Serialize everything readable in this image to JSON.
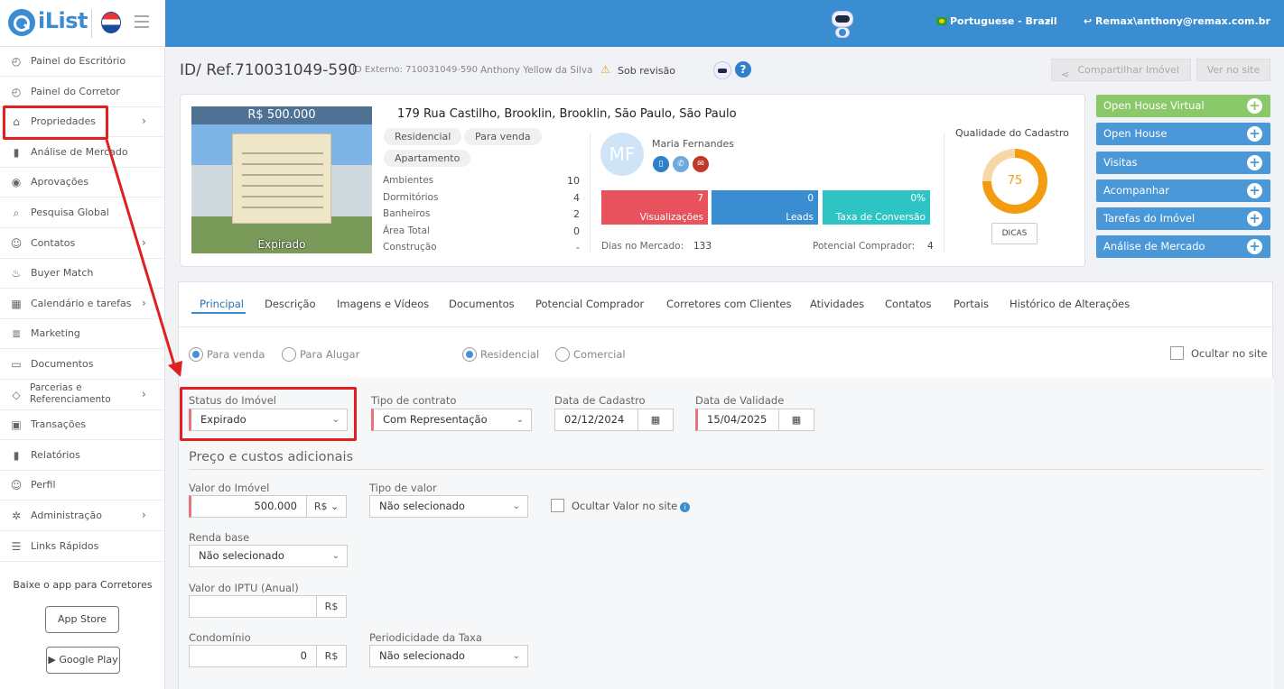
{
  "topbar": {
    "logo": "iList",
    "language": "Portuguese - Brazil",
    "user": "Remax\\anthony@remax.com.br"
  },
  "sidebar": {
    "items": [
      {
        "label": "Painel do Escritório",
        "icon": "dashboard-icon",
        "has_arrow": false
      },
      {
        "label": "Painel do Corretor",
        "icon": "dashboard-icon",
        "has_arrow": false
      },
      {
        "label": "Propriedades",
        "icon": "home-icon",
        "has_arrow": true
      },
      {
        "label": "Análise de Mercado",
        "icon": "bar-chart-icon",
        "has_arrow": false
      },
      {
        "label": "Aprovações",
        "icon": "eye-icon",
        "has_arrow": false
      },
      {
        "label": "Pesquisa Global",
        "icon": "search-icon",
        "has_arrow": false
      },
      {
        "label": "Contatos",
        "icon": "contacts-icon",
        "has_arrow": true
      },
      {
        "label": "Buyer Match",
        "icon": "fire-icon",
        "has_arrow": false
      },
      {
        "label": "Calendário e tarefas",
        "icon": "calendar-icon",
        "has_arrow": true
      },
      {
        "label": "Marketing",
        "icon": "newspaper-icon",
        "has_arrow": false
      },
      {
        "label": "Documentos",
        "icon": "folder-icon",
        "has_arrow": false
      },
      {
        "label": "Parcerias e Referenciamento",
        "icon": "handshake-icon",
        "has_arrow": true
      },
      {
        "label": "Transações",
        "icon": "briefcase-icon",
        "has_arrow": false
      },
      {
        "label": "Relatórios",
        "icon": "bar-chart-icon",
        "has_arrow": false
      },
      {
        "label": "Perfil",
        "icon": "user-icon",
        "has_arrow": false
      },
      {
        "label": "Administração",
        "icon": "gear-icon",
        "has_arrow": true
      },
      {
        "label": "Links Rápidos",
        "icon": "list-icon",
        "has_arrow": false
      }
    ],
    "app_promo": "Baixe o app para Corretores",
    "app_store": "App Store",
    "google_play": "Google Play"
  },
  "header": {
    "title": "ID/ Ref.710031049-590",
    "external_id": "ID Externo: 710031049-590",
    "agent_name": "Anthony Yellow da Silva",
    "status": "Sob revisão",
    "share_label": "Compartilhar Imóvel",
    "view_label": "Ver no site"
  },
  "property": {
    "price": "R$ 500.000",
    "photo_status": "Expirado",
    "address": "179 Rua Castilho, Brooklin, Brooklin, São Paulo, São Paulo",
    "chips": [
      "Residencial",
      "Para venda",
      "Apartamento"
    ],
    "attributes": [
      {
        "label": "Ambientes",
        "value": "10"
      },
      {
        "label": "Dormitórios",
        "value": "4"
      },
      {
        "label": "Banheiros",
        "value": "2"
      },
      {
        "label": "Área Total",
        "value": "0"
      },
      {
        "label": "Construção",
        "value": "-"
      }
    ],
    "agent": {
      "initials": "MF",
      "name": "Maria Fernandes"
    },
    "stats": [
      {
        "value": "7",
        "label": "Visualizações",
        "color": "#e8525c"
      },
      {
        "value": "0",
        "label": "Leads",
        "color": "#3a8dd1"
      },
      {
        "value": "0%",
        "label": "Taxa de Conversão",
        "color": "#2ec4c4"
      }
    ],
    "days_label": "Dias no Mercado:",
    "days_value": "133",
    "potential_label": "Potencial Comprador:",
    "potential_value": "4",
    "quality_title": "Qualidade do Cadastro",
    "quality_score": 75,
    "quality_color": "#f39c12",
    "dicas": "DICAS"
  },
  "actions": [
    {
      "label": "Open House Virtual",
      "color": "#8bc86a"
    },
    {
      "label": "Open House",
      "color": "#4a98d8"
    },
    {
      "label": "Visitas",
      "color": "#4a98d8"
    },
    {
      "label": "Acompanhar",
      "color": "#4a98d8"
    },
    {
      "label": "Tarefas do Imóvel",
      "color": "#4a98d8"
    },
    {
      "label": "Análise de Mercado",
      "color": "#4a98d8"
    }
  ],
  "tabs": [
    "Principal",
    "Descrição",
    "Imagens e Vídeos",
    "Documentos",
    "Potencial Comprador",
    "Corretores com Clientes",
    "Atividades",
    "Contatos",
    "Portais",
    "Histórico de Alterações"
  ],
  "form": {
    "radios": {
      "para_venda": "Para venda",
      "para_alugar": "Para Alugar",
      "residencial": "Residencial",
      "comercial": "Comercial"
    },
    "ocultar_site": "Ocultar no site",
    "status_label": "Status do Imóvel",
    "status_value": "Expirado",
    "contract_label": "Tipo de contrato",
    "contract_value": "Com Representação",
    "cadastro_label": "Data de Cadastro",
    "cadastro_value": "02/12/2024",
    "validade_label": "Data de Validade",
    "validade_value": "15/04/2025",
    "section_title": "Preço e custos adicionais",
    "valor_label": "Valor do Imóvel",
    "valor_value": "500.000",
    "valor_currency": "R$",
    "tipo_valor_label": "Tipo de valor",
    "tipo_valor_value": "Não selecionado",
    "ocultar_valor": "Ocultar Valor no site",
    "renda_label": "Renda base",
    "renda_value": "Não selecionado",
    "iptu_label": "Valor do IPTU (Anual)",
    "iptu_value": "",
    "iptu_currency": "R$",
    "condominio_label": "Condomínio",
    "condominio_value": "0",
    "condominio_currency": "R$",
    "periodicidade_label": "Periodicidade da Taxa",
    "periodicidade_value": "Não selecionado"
  }
}
